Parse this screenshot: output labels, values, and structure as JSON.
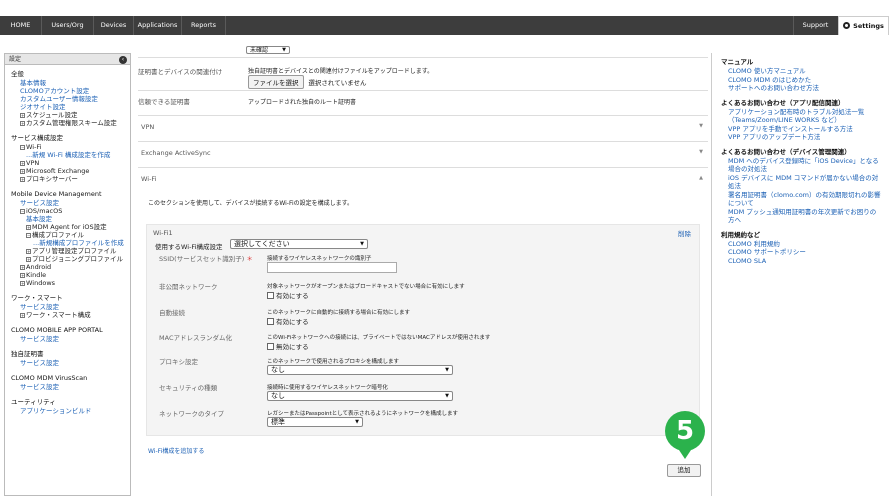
{
  "nav": {
    "home": "HOME",
    "users": "Users/Org",
    "devices": "Devices",
    "applications": "Applications",
    "reports": "Reports",
    "support": "Support",
    "settings": "Settings"
  },
  "sidebar": {
    "header": "設定",
    "general_title": "全般",
    "general_items": [
      "基本情報",
      "CLOMOアカウント設定",
      "カスタムユーザー情報設定",
      "ジオサイト設定"
    ],
    "schedule": "スケジュール設定",
    "custom_mgmt": "カスタム管理権限スキーム設定",
    "service_title": "サービス構成設定",
    "wifi": "Wi-Fi",
    "wifi_new": "...新規 Wi-Fi 構成設定を作成",
    "vpn": "VPN",
    "exchange": "Microsoft Exchange",
    "proxy": "プロキシサーバー",
    "mdm_title": "Mobile Device Management",
    "mdm_service": "サービス設定",
    "ios": "iOS/macOS",
    "ios_basic": "基本設定",
    "mdm_agent": "MDM Agent for iOS設定",
    "profile": "構成プロファイル",
    "profile_new": "...新規構成プロファイルを作成",
    "app_mgmt": "アプリ管理設定プロファイル",
    "provisioning": "プロビジョニングプロファイル",
    "android": "Android",
    "kindle": "Kindle",
    "windows": "Windows",
    "worksmart_title": "ワーク・スマート",
    "worksmart_service": "サービス設定",
    "worksmart_config": "ワーク・スマート構成",
    "portal_title": "CLOMO MOBILE APP PORTAL",
    "portal_service": "サービス設定",
    "cert_title": "独自証明書",
    "cert_service": "サービス設定",
    "virus_title": "CLOMO MDM VirusScan",
    "virus_service": "サービス設定",
    "utility_title": "ユーティリティ",
    "utility_build": "アプリケーションビルド"
  },
  "main": {
    "top_select": "未確認",
    "cert_assoc_label": "証明書とデバイスの関連付け",
    "cert_assoc_desc": "独自証明書とデバイスとの関連付けファイルをアップロードします。",
    "file_button": "ファイルを選択",
    "file_status": "選択されていません",
    "trusted_label": "信頼できる証明書",
    "trusted_desc": "アップロードされた独自のルート証明書",
    "vpn": "VPN",
    "exchange": "Exchange ActiveSync",
    "wifi": "Wi-Fi",
    "wifi_desc": "このセクションを使用して、デバイスが接続するWi-Fiの設定を構成します。",
    "add_wifi_link": "Wi-Fi構成を追加する",
    "add_button": "追加",
    "step_number": "5"
  },
  "wifi1": {
    "title": "Wi-Fi1",
    "delete": "削除",
    "use_label": "使用するWi-Fi構成設定",
    "use_select": "選択してください",
    "ssid_label": "SSID(サービスセット識別子)",
    "ssid_required": "＊",
    "ssid_desc": "接続するワイヤレスネットワークの識別子",
    "hidden_label": "非公開ネットワーク",
    "hidden_desc": "対象ネットワークがオープンまたはブロードキャストでない場合に有効にします",
    "hidden_check": "有効にする",
    "auto_label": "自動接続",
    "auto_desc": "このネットワークに自動的に接続する場合に有効にします",
    "auto_check": "有効にする",
    "mac_label": "MACアドレスランダム化",
    "mac_desc": "このWi-Fiネットワークへの接続には、プライベートではないMACアドレスが使用されます",
    "mac_check": "無効にする",
    "proxy_label": "プロキシ設定",
    "proxy_desc": "このネットワークで使用されるプロキシを構成します",
    "proxy_value": "なし",
    "security_label": "セキュリティの種類",
    "security_desc": "接続時に使用するワイヤレスネットワーク暗号化",
    "security_value": "なし",
    "nettype_label": "ネットワークのタイプ",
    "nettype_desc": "レガシーまたはPasspointとして表示されるようにネットワークを構成します",
    "nettype_value": "標準"
  },
  "rside": {
    "manual_title": "マニュアル",
    "manual_items": [
      "CLOMO 使い方マニュアル",
      "CLOMO MDM のはじめかた",
      "サポートへのお問い合わせ方法"
    ],
    "faq_app_title": "よくあるお問い合わせ（アプリ配信関連）",
    "faq_app_items": [
      "アプリケーション配布時のトラブル対処法一覧（Teams/Zoom/LINE WORKS など）",
      "VPP アプリを手動でインストールする方法",
      "VPP アプリのアップデート方法"
    ],
    "faq_dev_title": "よくあるお問い合わせ（デバイス管理関連）",
    "faq_dev_items": [
      "MDM へのデバイス登録時に「iOS Device」となる場合の対処法",
      "iOS デバイスに MDM コマンドが届かない場合の対処法",
      "署名用証明書（clomo.com）の有効期限切れの影響について",
      "MDM プッシュ通知用証明書の年次更新でお困りの方へ"
    ],
    "terms_title": "利用規約など",
    "terms_items": [
      "CLOMO 利用規約",
      "CLOMO サポートポリシー",
      "CLOMO SLA"
    ]
  }
}
